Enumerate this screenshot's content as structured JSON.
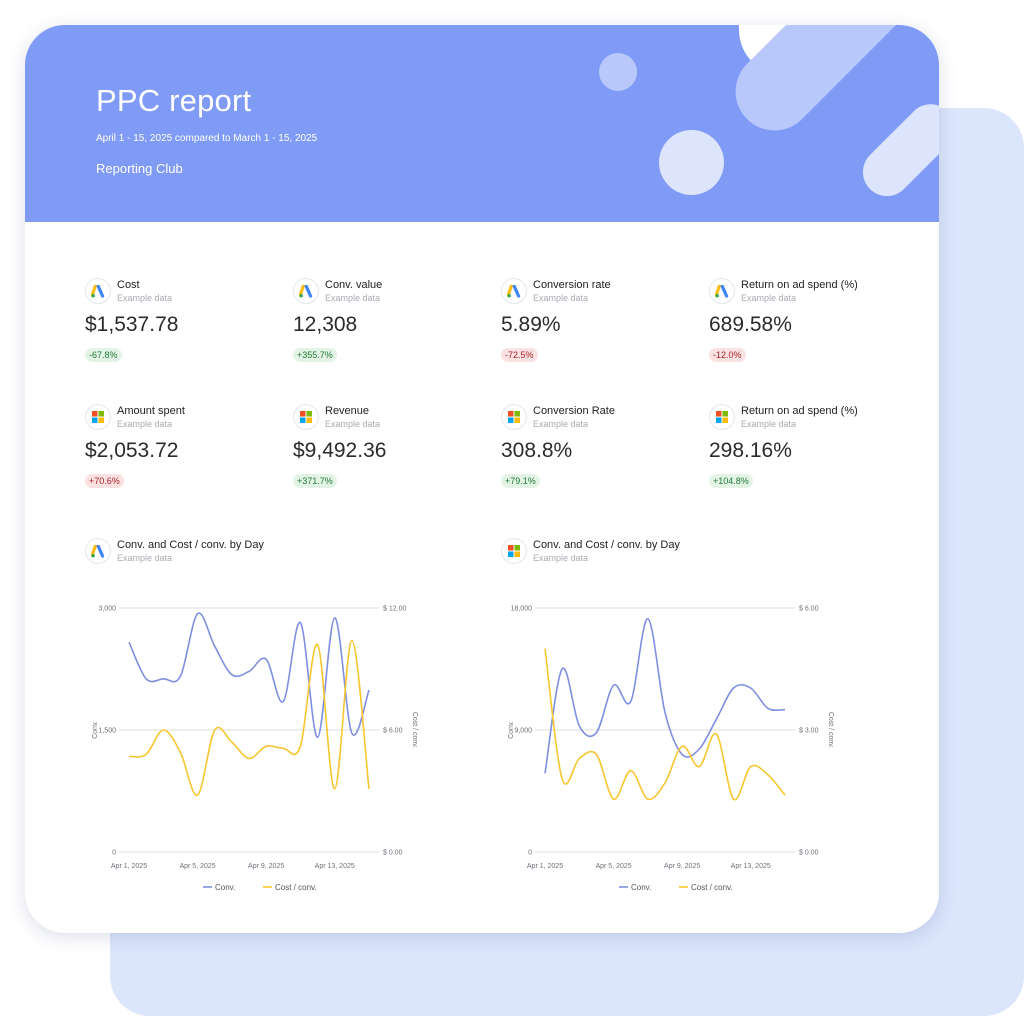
{
  "colors": {
    "accent": "#7f9bf5",
    "conv_line": "#7f8fe0",
    "cost_line": "#f7c62f",
    "badge_pos": "#217a36",
    "badge_neg": "#a8242b"
  },
  "header": {
    "title": "PPC report",
    "subtitle": "April 1 - 15, 2025 compared to March 1 - 15, 2025",
    "brand": "Reporting Club"
  },
  "kpis": [
    {
      "icon": "google-ads-icon",
      "name": "Cost",
      "desc": "Example data",
      "value": "$1,537.78",
      "change": "-67.8%",
      "trend": "pos"
    },
    {
      "icon": "google-ads-icon",
      "name": "Conv. value",
      "desc": "Example data",
      "value": "12,308",
      "change": "+355.7%",
      "trend": "pos"
    },
    {
      "icon": "google-ads-icon",
      "name": "Conversion rate",
      "desc": "Example data",
      "value": "5.89%",
      "change": "-72.5%",
      "trend": "neg"
    },
    {
      "icon": "google-ads-icon",
      "name": "Return on ad spend (%)",
      "desc": "Example data",
      "value": "689.58%",
      "change": "-12.0%",
      "trend": "neg"
    },
    {
      "icon": "microsoft-ads-icon",
      "name": "Amount spent",
      "desc": "Example data",
      "value": "$2,053.72",
      "change": "+70.6%",
      "trend": "neg"
    },
    {
      "icon": "microsoft-ads-icon",
      "name": "Revenue",
      "desc": "Example data",
      "value": "$9,492.36",
      "change": "+371.7%",
      "trend": "pos"
    },
    {
      "icon": "microsoft-ads-icon",
      "name": "Conversion Rate",
      "desc": "Example data",
      "value": "308.8%",
      "change": "+79.1%",
      "trend": "pos"
    },
    {
      "icon": "microsoft-ads-icon",
      "name": "Return on ad spend (%)",
      "desc": "Example data",
      "value": "298.16%",
      "change": "+104.8%",
      "trend": "pos"
    }
  ],
  "chart_data": [
    {
      "type": "line",
      "icon": "google-ads-icon",
      "title": "Conv. and Cost / conv. by Day",
      "desc": "Example data",
      "x": [
        "Apr 1, 2025",
        "Apr 2, 2025",
        "Apr 3, 2025",
        "Apr 4, 2025",
        "Apr 5, 2025",
        "Apr 6, 2025",
        "Apr 7, 2025",
        "Apr 8, 2025",
        "Apr 9, 2025",
        "Apr 10, 2025",
        "Apr 11, 2025",
        "Apr 12, 2025",
        "Apr 13, 2025",
        "Apr 14, 2025",
        "Apr 15, 2025"
      ],
      "x_ticks": [
        "Apr 1, 2025",
        "Apr 5, 2025",
        "Apr 9, 2025",
        "Apr 13, 2025"
      ],
      "ylabel": "Conv.",
      "y2label": "Cost / conv.",
      "ylim": [
        0,
        3000
      ],
      "y2lim": [
        0,
        12
      ],
      "y_ticks": [
        "0",
        "1,500",
        "3,000"
      ],
      "y2_ticks": [
        "$ 0.00",
        "$ 6.00",
        "$ 12.00"
      ],
      "grid": true,
      "legend": "bottom",
      "series": [
        {
          "name": "Conv.",
          "axis": "left",
          "values": [
            2580,
            2130,
            2130,
            2160,
            2930,
            2530,
            2180,
            2220,
            2370,
            1850,
            2820,
            1410,
            2880,
            1460,
            1990
          ]
        },
        {
          "name": "Cost / conv.",
          "axis": "right",
          "values": [
            4.7,
            4.8,
            6.0,
            4.9,
            2.8,
            6.0,
            5.4,
            4.6,
            5.2,
            5.1,
            5.2,
            10.2,
            3.1,
            10.4,
            3.1
          ]
        }
      ]
    },
    {
      "type": "line",
      "icon": "microsoft-ads-icon",
      "title": "Conv. and Cost / conv. by Day",
      "desc": "Example data",
      "x": [
        "Apr 1, 2025",
        "Apr 2, 2025",
        "Apr 3, 2025",
        "Apr 4, 2025",
        "Apr 5, 2025",
        "Apr 6, 2025",
        "Apr 7, 2025",
        "Apr 8, 2025",
        "Apr 9, 2025",
        "Apr 10, 2025",
        "Apr 11, 2025",
        "Apr 12, 2025",
        "Apr 13, 2025",
        "Apr 14, 2025",
        "Apr 15, 2025"
      ],
      "x_ticks": [
        "Apr 1, 2025",
        "Apr 5, 2025",
        "Apr 9, 2025",
        "Apr 13, 2025"
      ],
      "ylabel": "Conv.",
      "y2label": "Cost / conv.",
      "ylim": [
        0,
        18000
      ],
      "y2lim": [
        0,
        6
      ],
      "y_ticks": [
        "0",
        "9,000",
        "18,000"
      ],
      "y2_ticks": [
        "$ 0.00",
        "$ 3.00",
        "$ 6.00"
      ],
      "grid": true,
      "legend": "bottom",
      "series": [
        {
          "name": "Conv.",
          "axis": "left",
          "values": [
            5800,
            13500,
            9300,
            8800,
            12300,
            11100,
            17200,
            10300,
            7200,
            7600,
            9800,
            12100,
            12100,
            10600,
            10500
          ]
        },
        {
          "name": "Cost / conv.",
          "axis": "right",
          "values": [
            5.0,
            1.8,
            2.3,
            2.4,
            1.3,
            2.0,
            1.3,
            1.7,
            2.6,
            2.1,
            2.9,
            1.3,
            2.1,
            1.9,
            1.4
          ]
        }
      ]
    }
  ]
}
